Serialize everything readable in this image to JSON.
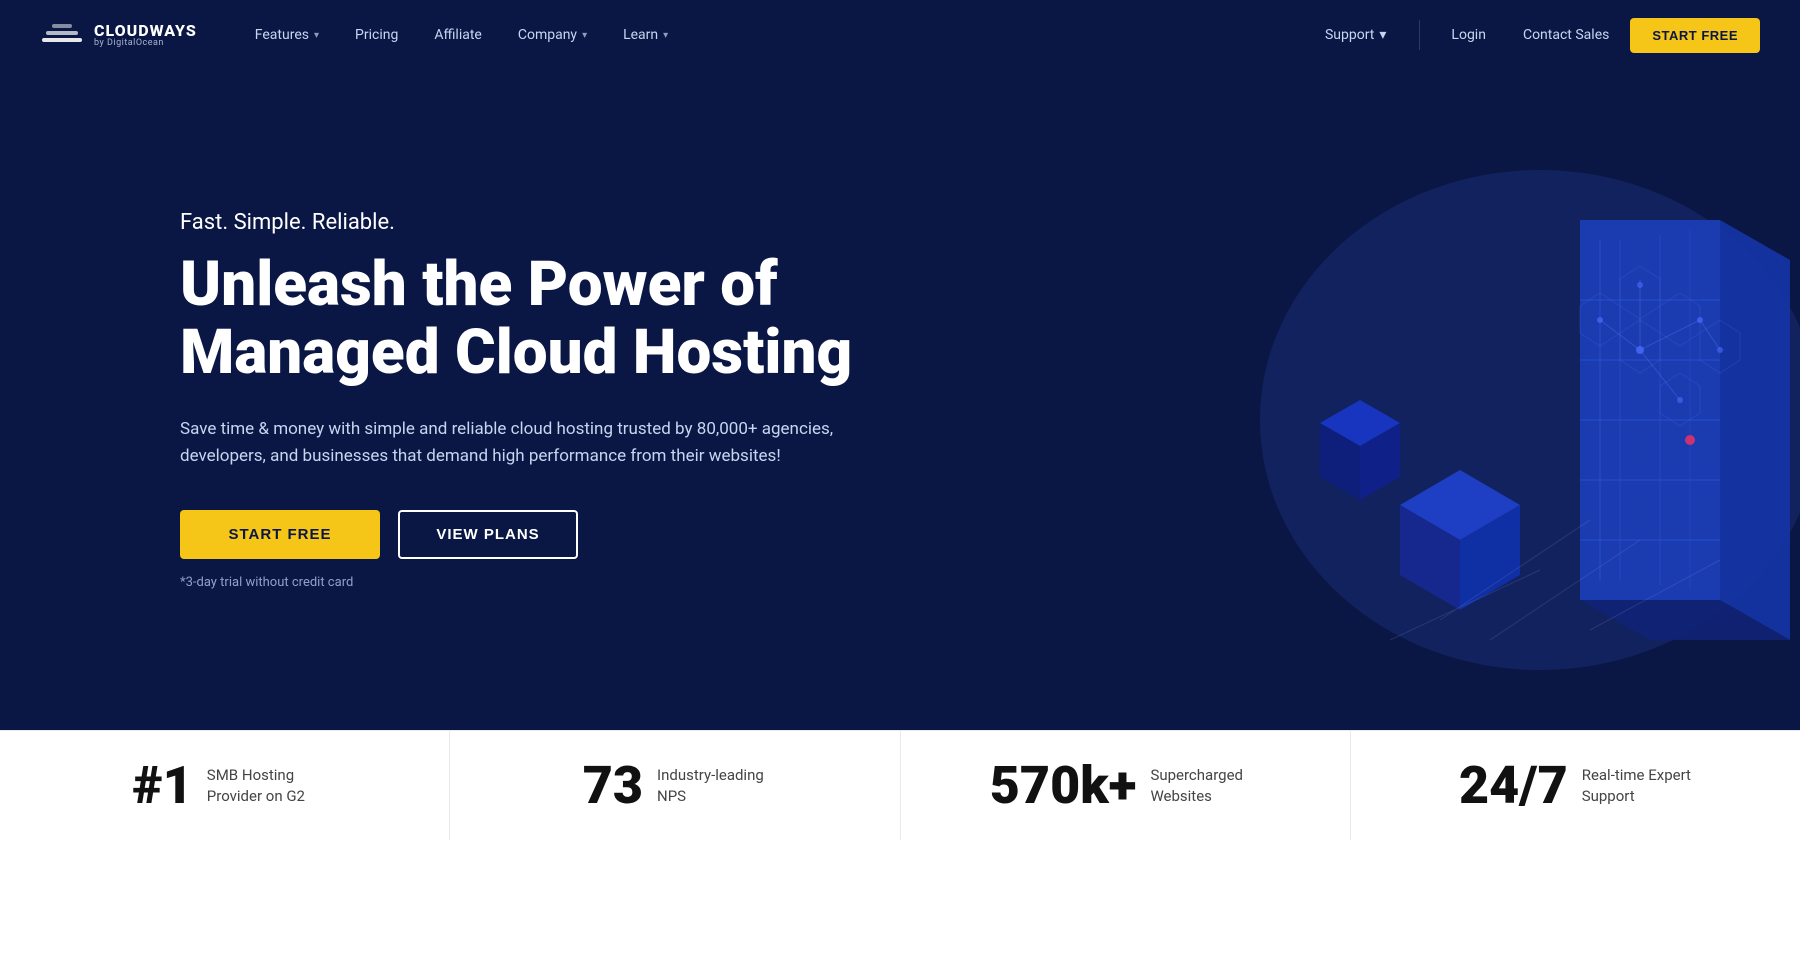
{
  "brand": {
    "name": "CLOUDWAYS",
    "sub": "by DigitalOcean",
    "logo_alt": "Cloudways logo"
  },
  "nav": {
    "links": [
      {
        "id": "features",
        "label": "Features",
        "has_dropdown": true
      },
      {
        "id": "pricing",
        "label": "Pricing",
        "has_dropdown": false
      },
      {
        "id": "affiliate",
        "label": "Affiliate",
        "has_dropdown": false
      },
      {
        "id": "company",
        "label": "Company",
        "has_dropdown": true
      },
      {
        "id": "learn",
        "label": "Learn",
        "has_dropdown": true
      }
    ],
    "right": {
      "support": "Support",
      "login": "Login",
      "contact": "Contact Sales",
      "cta": "START FREE"
    }
  },
  "hero": {
    "tagline": "Fast. Simple. Reliable.",
    "title_line1": "Unleash the Power of",
    "title_line2": "Managed Cloud Hosting",
    "description": "Save time & money with simple and reliable cloud hosting trusted by 80,000+ agencies, developers, and businesses that demand high performance from their websites!",
    "btn_start": "START FREE",
    "btn_plans": "VIEW PLANS",
    "trial_note": "*3-day trial without credit card"
  },
  "stats": [
    {
      "id": "stat-rank",
      "number": "#1",
      "desc": "SMB Hosting Provider on G2"
    },
    {
      "id": "stat-nps",
      "number": "73",
      "desc": "Industry-leading NPS"
    },
    {
      "id": "stat-websites",
      "number": "570k+",
      "desc": "Supercharged Websites"
    },
    {
      "id": "stat-support",
      "number": "24/7",
      "desc": "Real-time Expert Support"
    }
  ]
}
